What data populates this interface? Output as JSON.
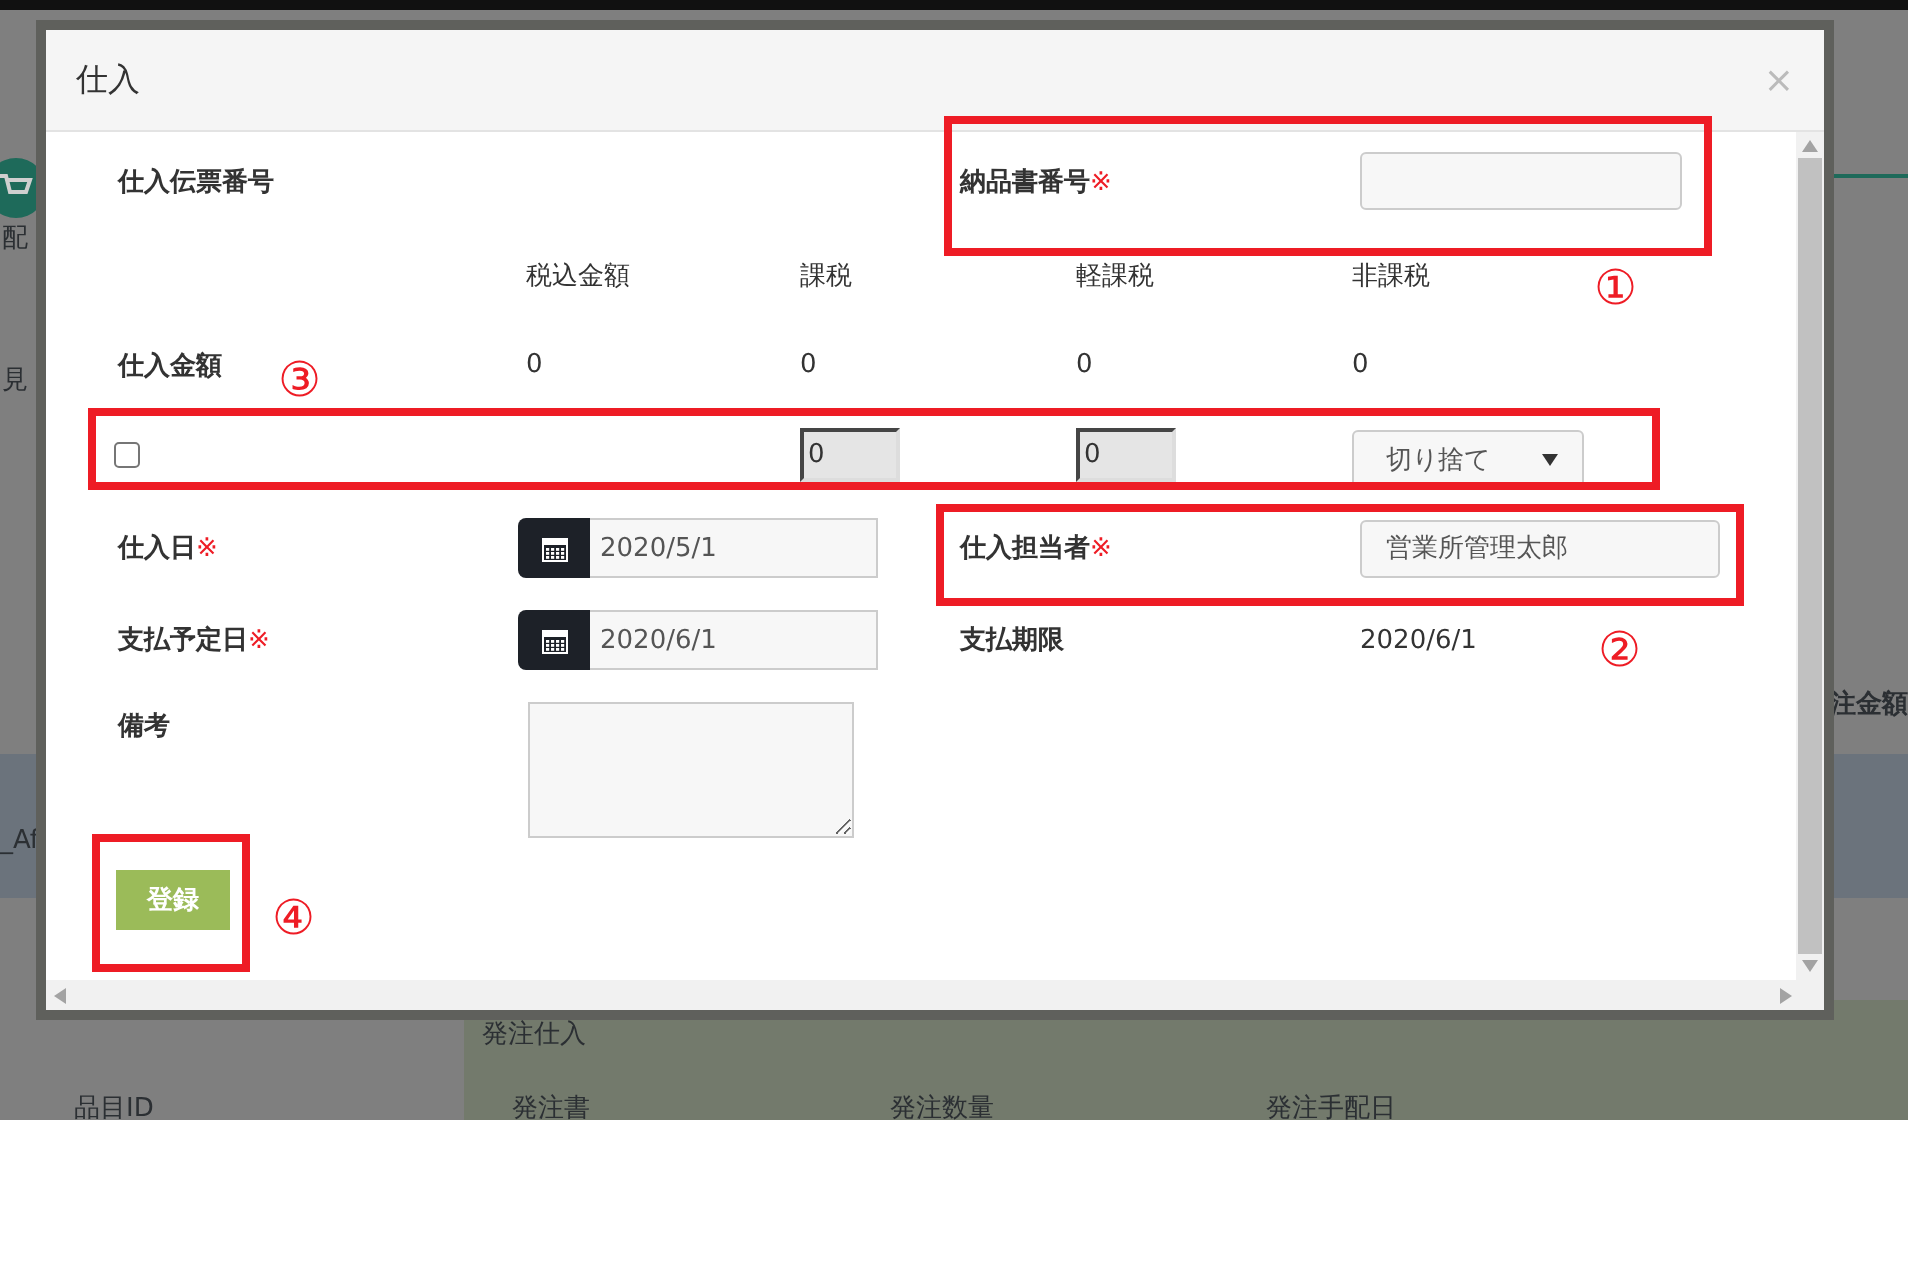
{
  "backdrop": {
    "texts": [
      "配",
      "見",
      "_Af",
      "注金額",
      "発注仕入",
      "品目ID",
      "発注書",
      "発注数量",
      "発注手配日"
    ]
  },
  "dialog": {
    "title": "仕入",
    "close": "×"
  },
  "form": {
    "slip_number": {
      "label": "仕入伝票番号"
    },
    "invoice_number": {
      "label": "納品書番号",
      "required_mark": "※"
    },
    "amount_columns": [
      "税込金額",
      "課税",
      "軽課税",
      "非課税"
    ],
    "amount": {
      "label": "仕入金額",
      "values": [
        "0",
        "0",
        "0",
        "0"
      ]
    },
    "tax_row": {
      "checked": false,
      "taxable": "0",
      "reduced": "0",
      "rounding": "切り捨て"
    },
    "purchase_date": {
      "label": "仕入日",
      "required_mark": "※",
      "value": "2020/5/1"
    },
    "buyer": {
      "label": "仕入担当者",
      "required_mark": "※",
      "value": "営業所管理太郎"
    },
    "payment_due_date": {
      "label": "支払予定日",
      "required_mark": "※",
      "value": "2020/6/1"
    },
    "payment_deadline": {
      "label": "支払期限",
      "value": "2020/6/1"
    },
    "remarks": {
      "label": "備考"
    },
    "submit": "登録"
  },
  "annotations": [
    {
      "label": "①"
    },
    {
      "label": "②"
    },
    {
      "label": "③"
    },
    {
      "label": "④"
    }
  ]
}
